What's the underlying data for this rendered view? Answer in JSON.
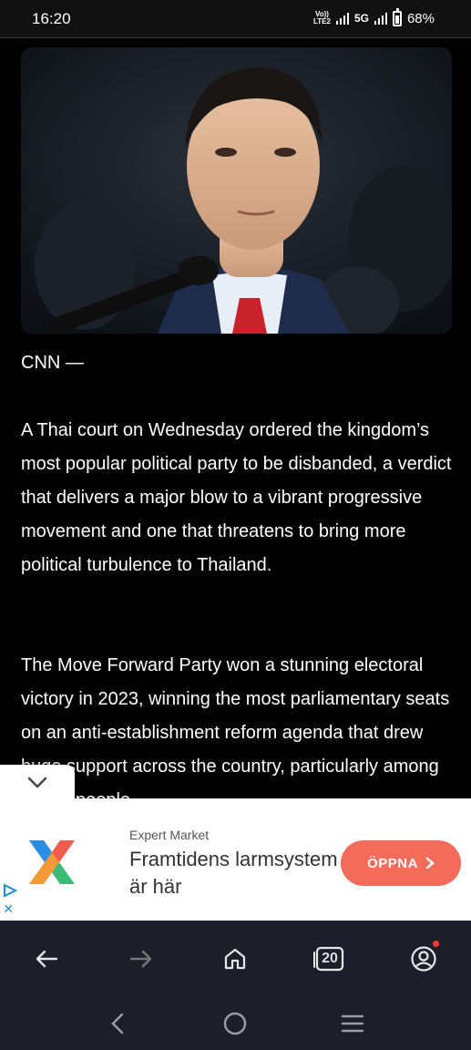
{
  "status_bar": {
    "time": "16:20",
    "volte_line1": "Vo))",
    "volte_line2": "LTE2",
    "network": "5G",
    "battery_percent": "68%",
    "battery_level": 0.68
  },
  "article": {
    "image_icon": "photo-portrait",
    "byline": "CNN —",
    "paragraphs": [
      "A Thai court on Wednesday ordered the kingdom’s most popular political party to be disbanded, a verdict that delivers a major blow to a vibrant progressive movement and one that threatens to bring more political turbulence to Thailand.",
      "The Move Forward Party won a stunning electoral victory in 2023, winning the most parliamentary seats on an anti-establishment reform agenda that drew huge support across the country, particularly among young people"
    ]
  },
  "collapse_tab": {
    "icon": "chevron-down-icon"
  },
  "ad": {
    "brand": "Expert Market",
    "title": "Framtidens larmsystem är här",
    "cta_label": "ÖPPNA",
    "cta_icon": "chevron-right-icon",
    "adchoices_icon": "adchoices-icon",
    "close_label": "×",
    "colors": {
      "cta": "#f26b5b",
      "logo_blue": "#2b8de3",
      "logo_green": "#3dbb76",
      "logo_orange": "#f29a3a",
      "logo_red": "#ee5c4d"
    }
  },
  "toolbar": {
    "back_icon": "arrow-left-icon",
    "forward_icon": "arrow-right-icon",
    "home_icon": "home-icon",
    "tabs_count": "20",
    "account_icon": "account-icon"
  },
  "system_nav": {
    "back_icon": "chevron-left-icon",
    "home_icon": "circle-home-icon",
    "recents_icon": "menu-lines-icon"
  }
}
